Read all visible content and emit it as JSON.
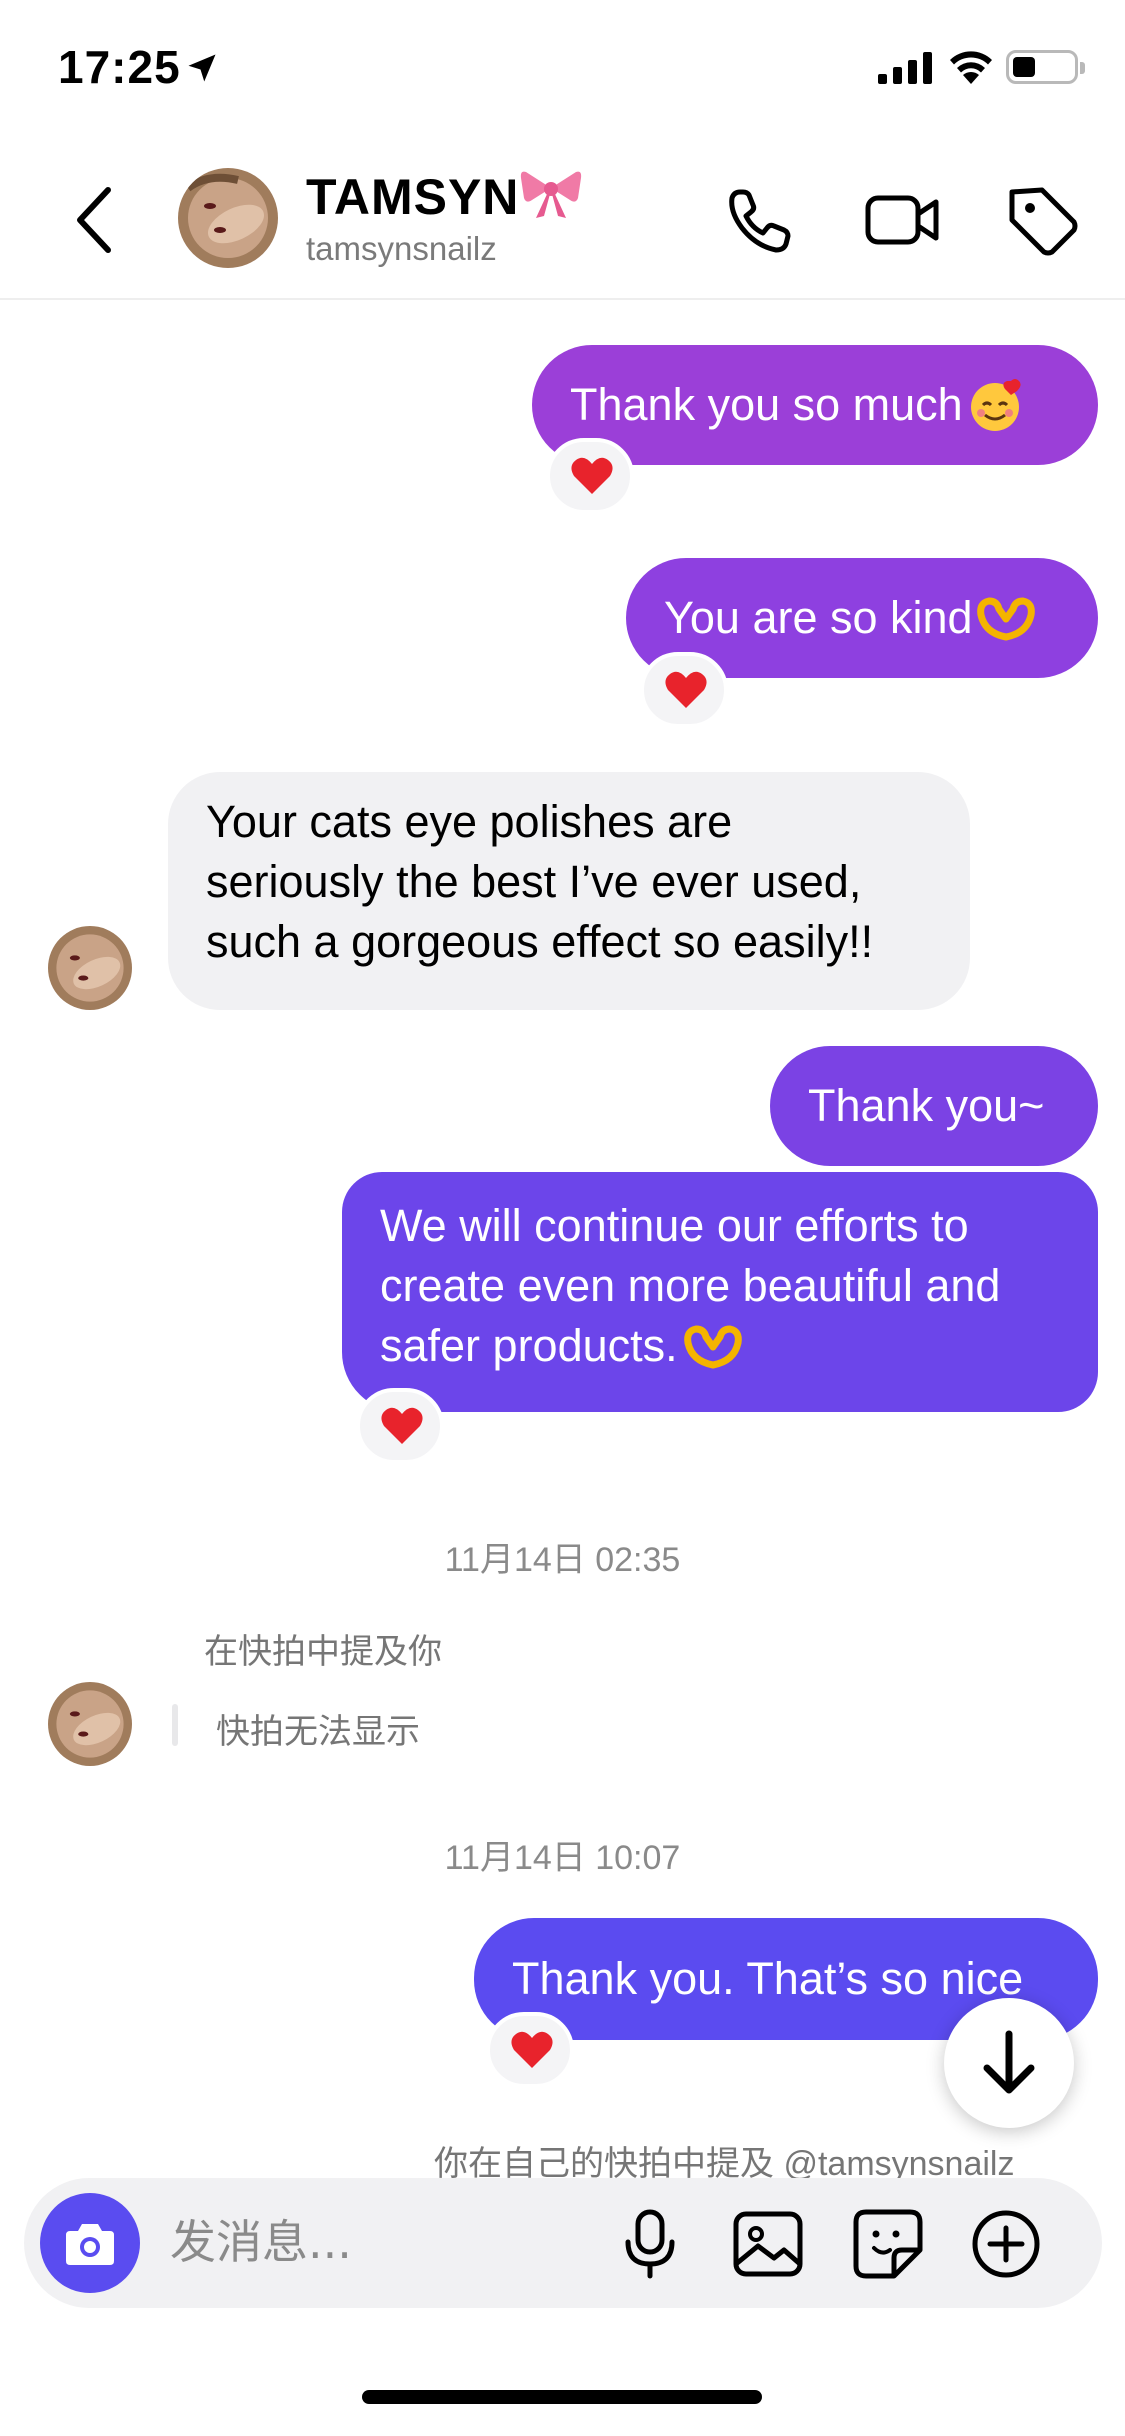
{
  "status_bar": {
    "time": "17:25",
    "icons": [
      "location-arrow-icon",
      "cellular-signal-icon",
      "wifi-icon",
      "battery-icon"
    ]
  },
  "header": {
    "name": "TAMSYN",
    "username": "tamsynsnailz",
    "icons": [
      "back-chevron-icon",
      "ribbon-bow-icon",
      "phone-icon",
      "video-camera-icon",
      "tag-icon"
    ]
  },
  "messages": [
    {
      "side": "out",
      "text": "Thank you so much",
      "emoji": "smiling-face-with-hearts",
      "reaction": "heart"
    },
    {
      "side": "out",
      "text": "You are so kind",
      "emoji": "heart-hands",
      "reaction": "heart"
    },
    {
      "side": "in",
      "lines": [
        "Your cats eye polishes are",
        "seriously the best I’ve ever used,",
        "such a gorgeous effect so easily!!"
      ]
    },
    {
      "side": "out",
      "text": "Thank you~"
    },
    {
      "side": "out",
      "lines": [
        "We will continue our efforts to",
        "create even more beautiful and",
        "safer products."
      ],
      "emoji": "heart-hands",
      "reaction": "heart"
    }
  ],
  "events": {
    "timestamp_1": "11月14日 02:35",
    "mention_label": "在快拍中提及你",
    "story_unavailable": "快拍无法显示",
    "timestamp_2": "11月14日 10:07",
    "last_message": "Thank you. That’s so nice",
    "self_mention": "你在自己的快拍中提及 @tamsynsnailz"
  },
  "composer": {
    "placeholder": "发消息..."
  },
  "colors": {
    "bubble_purple_top": "#9b3fdc",
    "bubble_purple_mid": "#7b42e6",
    "bubble_blue_violet": "#5b4bf0",
    "incoming_bubble": "#f1f1f3",
    "camera_button": "#5a4cf0",
    "reaction_heart": "#e8232c"
  }
}
